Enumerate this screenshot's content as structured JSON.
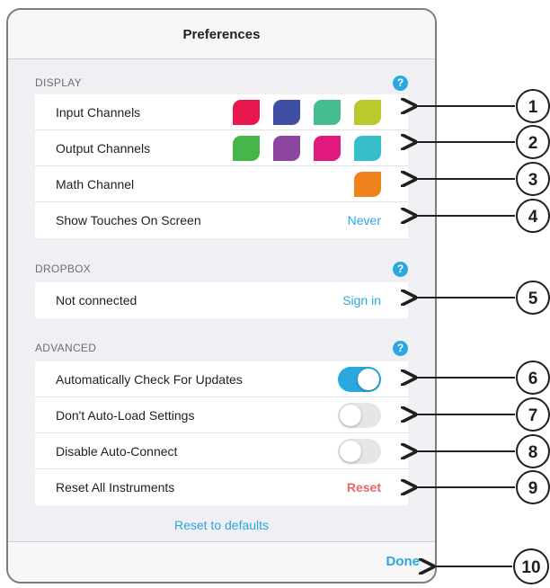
{
  "title": "Preferences",
  "colors": {
    "accent": "#2aa8e0",
    "reset": "#e8666b"
  },
  "display": {
    "header": "DISPLAY",
    "input_channels": {
      "label": "Input Channels",
      "colors": [
        "#e8184f",
        "#3e4fa4",
        "#45bd8f",
        "#b9c92e"
      ]
    },
    "output_channels": {
      "label": "Output Channels",
      "colors": [
        "#45b64a",
        "#8c45a0",
        "#e2187c",
        "#36bfc9"
      ]
    },
    "math_channel": {
      "label": "Math Channel",
      "colors": [
        "#f0821e"
      ]
    },
    "show_touches": {
      "label": "Show Touches On Screen",
      "value": "Never"
    }
  },
  "dropbox": {
    "header": "DROPBOX",
    "status": {
      "label": "Not connected",
      "action": "Sign in"
    }
  },
  "advanced": {
    "header": "ADVANCED",
    "auto_check_updates": {
      "label": "Automatically Check For Updates",
      "on": true
    },
    "no_autoload": {
      "label": "Don't Auto-Load Settings",
      "on": false
    },
    "disable_autoconnect": {
      "label": "Disable Auto-Connect",
      "on": false
    },
    "reset_instruments": {
      "label": "Reset All Instruments",
      "action": "Reset"
    }
  },
  "help_glyph": "?",
  "reset_defaults": "Reset to defaults",
  "done": "Done",
  "callouts": [
    "1",
    "2",
    "3",
    "4",
    "5",
    "6",
    "7",
    "8",
    "9",
    "10"
  ]
}
